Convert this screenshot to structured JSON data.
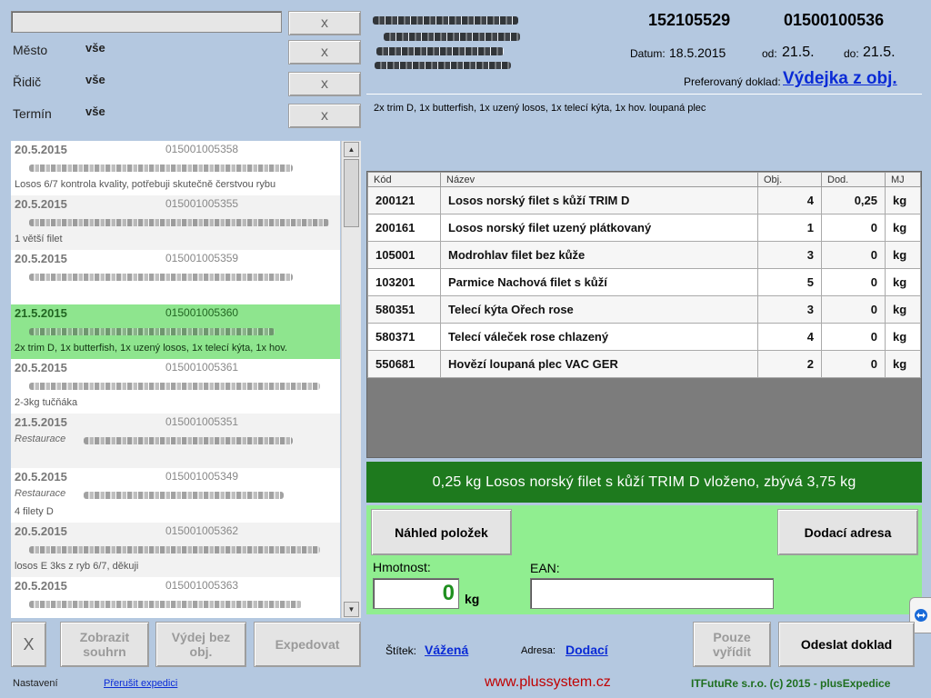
{
  "filters": {
    "search_value": "",
    "clear_label": "x",
    "rows": [
      {
        "label": "Město",
        "value": "vše"
      },
      {
        "label": "Řidič",
        "value": "vše"
      },
      {
        "label": "Termín",
        "value": "vše"
      }
    ]
  },
  "header": {
    "id1": "152105529",
    "id2": "01500100536",
    "datum_label": "Datum:",
    "datum_value": "18.5.2015",
    "od_label": "od:",
    "od_value": "21.5.",
    "do_label": "do:",
    "do_value": "21.5.",
    "preferred_label": "Preferovaný doklad:",
    "preferred_value": "Výdejka z obj.",
    "summary": "2x trim D, 1x butterfish, 1x uzený losos, 1x telecí kýta, 1x hov. loupaná plec"
  },
  "orders": [
    {
      "date": "20.5.2015",
      "number": "015001005358",
      "note": "",
      "detail": "Losos 6/7 kontrola kvality, potřebuji skutečně čerstvou rybu",
      "selected": false
    },
    {
      "date": "20.5.2015",
      "number": "015001005355",
      "note": "",
      "detail": "1 větší filet",
      "selected": false
    },
    {
      "date": "20.5.2015",
      "number": "015001005359",
      "note": "",
      "detail": "",
      "selected": false
    },
    {
      "date": "21.5.2015",
      "number": "015001005360",
      "note": "",
      "detail": "2x trim D, 1x butterfish, 1x uzený losos, 1x telecí kýta, 1x hov.",
      "selected": true
    },
    {
      "date": "20.5.2015",
      "number": "015001005361",
      "note": "",
      "detail": "2-3kg tučňáka",
      "selected": false
    },
    {
      "date": "21.5.2015",
      "number": "015001005351",
      "note": "Restaurace",
      "detail": "",
      "selected": false
    },
    {
      "date": "20.5.2015",
      "number": "015001005349",
      "note": "Restaurace",
      "detail": "4 filety D",
      "selected": false
    },
    {
      "date": "20.5.2015",
      "number": "015001005362",
      "note": "",
      "detail": "losos E 3ks z ryb 6/7, děkuji",
      "selected": false
    },
    {
      "date": "20.5.2015",
      "number": "015001005363",
      "note": "",
      "detail": "",
      "selected": false
    }
  ],
  "table": {
    "headers": [
      "Kód",
      "Název",
      "Obj.",
      "Dod.",
      "MJ"
    ],
    "rows": [
      [
        "200121",
        "Losos norský filet s kůží TRIM D",
        "4",
        "0,25",
        "kg"
      ],
      [
        "200161",
        "Losos norský filet uzený plátkovaný",
        "1",
        "0",
        "kg"
      ],
      [
        "105001",
        "Modrohlav filet bez kůže",
        "3",
        "0",
        "kg"
      ],
      [
        "103201",
        "Parmice Nachová filet s kůží",
        "5",
        "0",
        "kg"
      ],
      [
        "580351",
        "Telecí kýta Ořech rose",
        "3",
        "0",
        "kg"
      ],
      [
        "580371",
        "Telecí váleček rose chlazený",
        "4",
        "0",
        "kg"
      ],
      [
        "550681",
        "Hovězí loupaná plec VAC GER",
        "2",
        "0",
        "kg"
      ]
    ]
  },
  "status_message": "0,25 kg Losos norský filet s kůží TRIM D  vloženo, zbývá 3,75 kg",
  "entry": {
    "preview_button": "Náhled položek",
    "delivery_button": "Dodací adresa",
    "weight_label": "Hmotnost:",
    "weight_value": "0",
    "weight_unit": "kg",
    "ean_label": "EAN:",
    "ean_value": ""
  },
  "bottom": {
    "clear_label": "X",
    "summary_button": "Zobrazit souhrn",
    "issue_button": "Výdej bez obj.",
    "dispatch_button": "Expedovat",
    "label_label": "Štítek:",
    "label_value": "Vážená",
    "address_label": "Adresa:",
    "address_value": "Dodací",
    "settle_button": "Pouze vyřídit",
    "send_button": "Odeslat doklad",
    "settings_label": "Nastavení",
    "interrupt_link": "Přerušit expedici",
    "website": "www.plussystem.cz",
    "copyright": "ITFutuRe s.r.o. (c) 2015 - plusExpedice"
  },
  "colors": {
    "background": "#b4c8e0",
    "selected_row": "#8ee58e",
    "status_bar": "#1e7a1e",
    "entry_panel": "#90ee90",
    "link": "#0a2bd6",
    "website": "#c00000"
  }
}
